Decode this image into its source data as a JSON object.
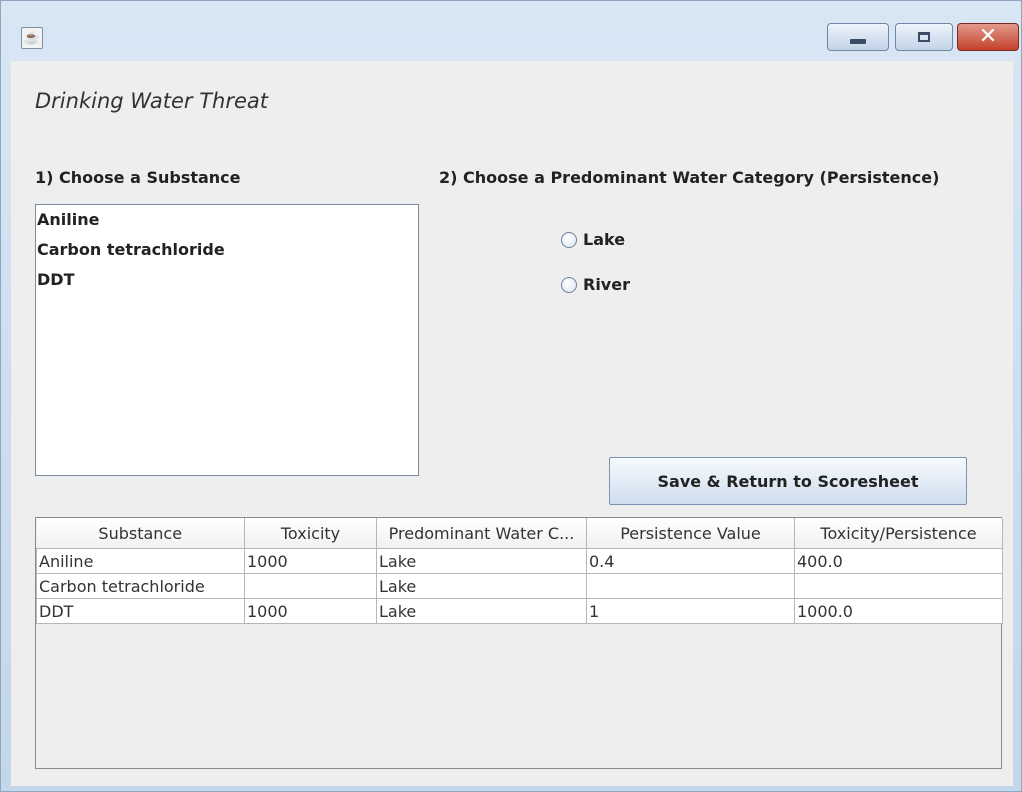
{
  "window": {
    "icon": "java-coffee-icon",
    "controls": [
      "minimize-icon",
      "maximize-icon",
      "close-icon"
    ]
  },
  "form": {
    "title": "Drinking Water Threat",
    "substance_label": "1) Choose a Substance",
    "category_label": "2) Choose a Predominant Water Category (Persistence)",
    "substances": [
      "Aniline",
      "Carbon tetrachloride",
      "DDT"
    ],
    "radios": {
      "lake": "Lake",
      "river": "River"
    },
    "save_button": "Save & Return to Scoresheet"
  },
  "table": {
    "headers": [
      "Substance",
      "Toxicity",
      "Predominant Water C...",
      "Persistence Value",
      "Toxicity/Persistence"
    ],
    "rows": [
      [
        "Aniline",
        "1000",
        "Lake",
        "0.4",
        "400.0"
      ],
      [
        "Carbon tetrachloride",
        "",
        "Lake",
        "",
        ""
      ],
      [
        "DDT",
        "1000",
        "Lake",
        "1",
        "1000.0"
      ]
    ]
  },
  "colors": {
    "title_bar": "#c9dbee",
    "close_button": "#c2412c"
  }
}
